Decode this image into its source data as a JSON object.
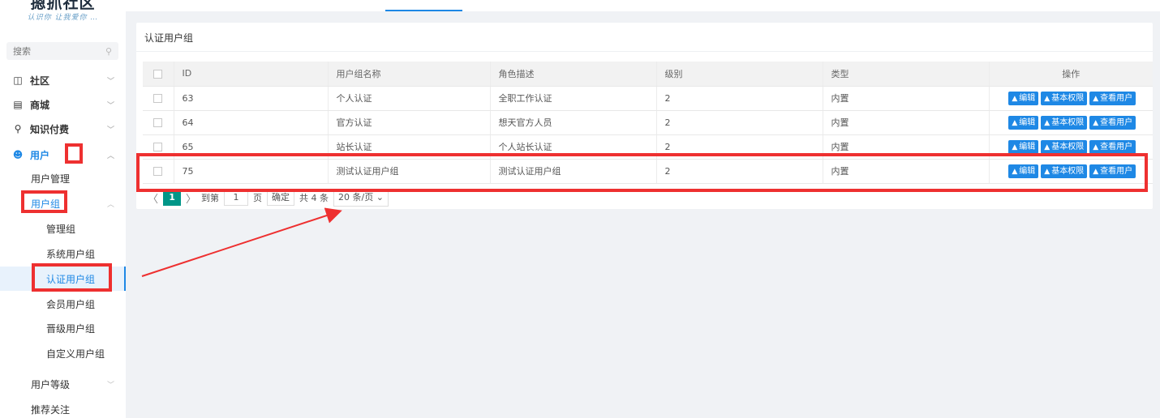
{
  "logo": {
    "title": "摁抓社区",
    "subtitle": "认识你 让我爱你 …"
  },
  "search": {
    "placeholder": "搜索"
  },
  "sidebar": {
    "items": [
      {
        "label": "社区",
        "icon": "chat-icon"
      },
      {
        "label": "商城",
        "icon": "store-icon"
      },
      {
        "label": "知识付费",
        "icon": "bulb-icon"
      },
      {
        "label": "用户",
        "icon": "user-icon"
      },
      {
        "label": "用户管理"
      },
      {
        "label": "用户组"
      },
      {
        "label": "管理组"
      },
      {
        "label": "系统用户组"
      },
      {
        "label": "认证用户组"
      },
      {
        "label": "会员用户组"
      },
      {
        "label": "晋级用户组"
      },
      {
        "label": "自定义用户组"
      },
      {
        "label": "用户等级"
      },
      {
        "label": "推荐关注"
      }
    ]
  },
  "main": {
    "card_title": "认证用户组",
    "columns": [
      "ID",
      "用户组名称",
      "角色描述",
      "级别",
      "类型",
      "操作"
    ],
    "rows": [
      {
        "id": "63",
        "name": "个人认证",
        "desc": "全职工作认证",
        "level": "2",
        "type": "内置"
      },
      {
        "id": "64",
        "name": "官方认证",
        "desc": "想天官方人员",
        "level": "2",
        "type": "内置"
      },
      {
        "id": "65",
        "name": "站长认证",
        "desc": "个人站长认证",
        "level": "2",
        "type": "内置"
      },
      {
        "id": "75",
        "name": "测试认证用户组",
        "desc": "测试认证用户组",
        "level": "2",
        "type": "内置"
      }
    ],
    "actions": {
      "edit": "编辑",
      "perm": "基本权限",
      "view": "查看用户"
    }
  },
  "pager": {
    "current": "1",
    "goto_label": "到第",
    "goto_value": "1",
    "page_unit": "页",
    "confirm": "确定",
    "total": "共 4 条",
    "page_size": "20 条/页"
  },
  "colors": {
    "accent": "#1e88e5",
    "pager_active": "#009688",
    "annotation": "#ee3030"
  }
}
